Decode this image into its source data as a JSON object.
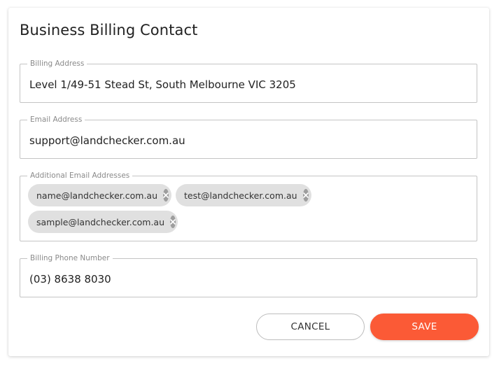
{
  "dialog": {
    "title": "Business Billing Contact"
  },
  "fields": {
    "billing_address": {
      "label": "Billing Address",
      "value": "Level 1/49-51 Stead St, South Melbourne VIC 3205"
    },
    "email_address": {
      "label": "Email Address",
      "value": "support@landchecker.com.au"
    },
    "additional_emails": {
      "label": "Additional Email Addresses",
      "chips": [
        "name@landchecker.com.au",
        "test@landchecker.com.au",
        "sample@landchecker.com.au"
      ]
    },
    "billing_phone": {
      "label": "Billing Phone Number",
      "value": "(03) 8638 8030"
    }
  },
  "actions": {
    "cancel_label": "CANCEL",
    "save_label": "SAVE"
  },
  "colors": {
    "accent": "#fb5a36",
    "chip_bg": "#e0e0e0",
    "chip_delete": "#9e9e9e",
    "border": "#c4c4c4"
  },
  "icons": {
    "chip_delete": "close-circle-icon"
  }
}
